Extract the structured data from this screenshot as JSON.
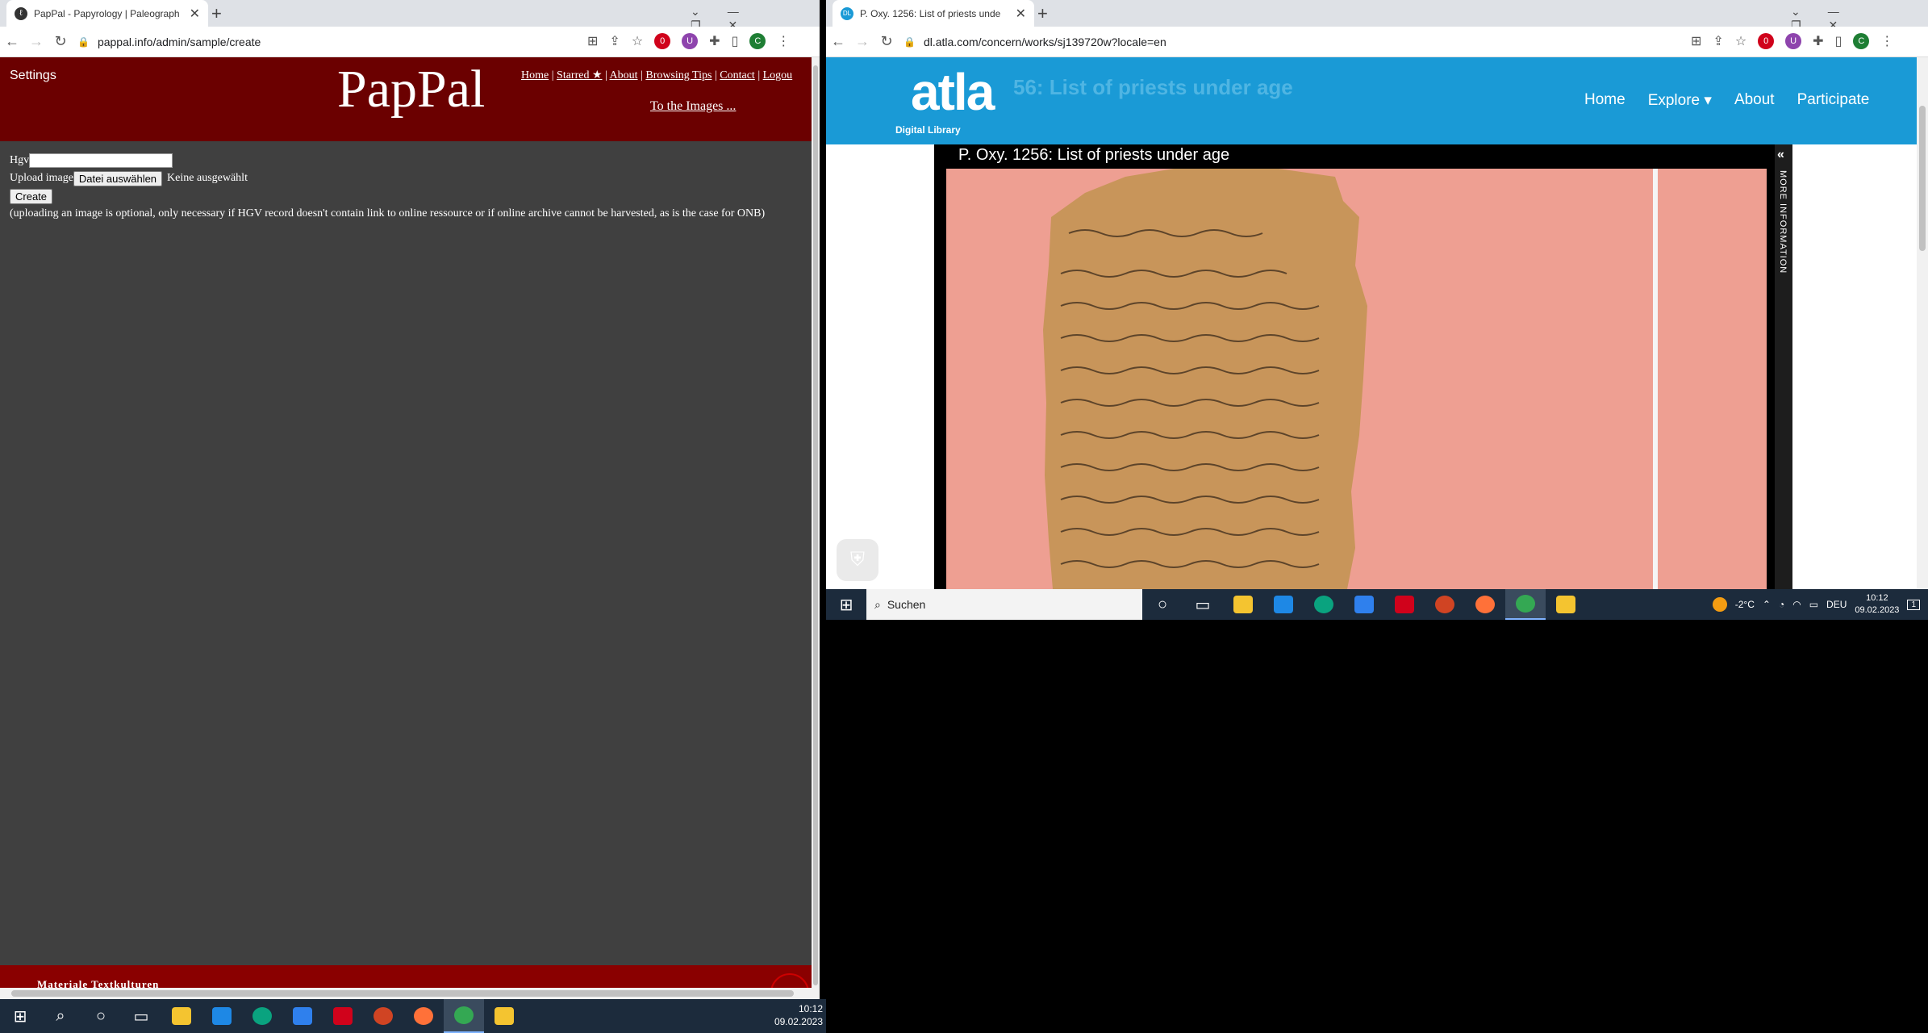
{
  "left_window": {
    "tab": {
      "favicon": "ℓ",
      "title": "PapPal - Papyrology | Paleograph",
      "close": "✕"
    },
    "url": "pappal.info/admin/sample/create",
    "header": {
      "settings": "Settings",
      "logo": "PapPal",
      "nav": [
        "Home",
        "Starred ★",
        "About",
        "Browsing Tips",
        "Contact",
        "Logou"
      ],
      "to_images": "To the Images ..."
    },
    "form": {
      "hgv_label": "Hgv",
      "hgv_value": "",
      "upload_label": "Upload image",
      "file_button": "Datei auswählen",
      "file_status": "Keine ausgewählt",
      "create_button": "Create",
      "note": "(uploading an image is optional, only necessary if HGV record doesn't contain link to online ressource or if online archive cannot be harvested, as is the case for ONB)"
    },
    "footer": "Materiale Textkulturen"
  },
  "right_window": {
    "tab": {
      "favicon": "DL",
      "title": "P. Oxy. 1256: List of priests unde",
      "close": "✕"
    },
    "url": "dl.atla.com/concern/works/sj139720w?locale=en",
    "header": {
      "ghost_title": "56: List of priests under age",
      "logo": "atla",
      "logo_sub": "Digital Library",
      "nav": [
        "Home",
        "Explore ▾",
        "About",
        "Participate"
      ]
    },
    "viewer": {
      "title": "P. Oxy. 1256: List of priests under age",
      "side_label": "MORE INFORMATION",
      "side_chevron": "«"
    }
  },
  "taskbar_left": {
    "time": "10:12",
    "date": "09.02.2023"
  },
  "taskbar_right": {
    "search_placeholder": "Suchen",
    "temperature": "-2°C",
    "language": "DEU",
    "time": "10:12",
    "date": "09.02.2023",
    "notif_count": "1"
  },
  "colors": {
    "pappal_red": "#6b0000",
    "pappal_bg": "#404040",
    "atla_blue": "#1a9ad6",
    "papyrus_bg": "#ee9f92"
  }
}
